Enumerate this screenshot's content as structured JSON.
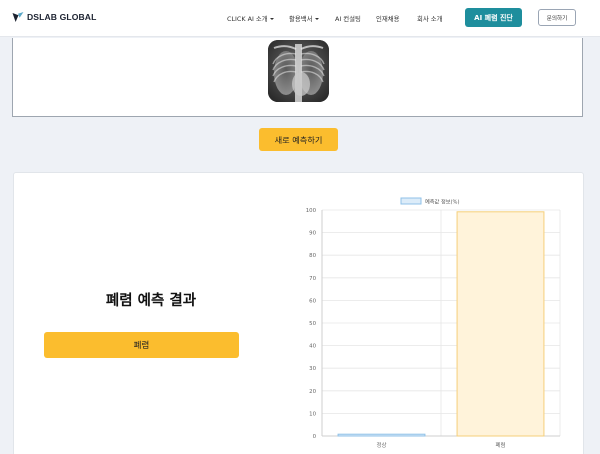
{
  "nav": {
    "brand": "DSLAB GLOBAL",
    "items": [
      {
        "label": "CLICK AI 소개",
        "dropdown": true
      },
      {
        "label": "활용백서",
        "dropdown": true
      },
      {
        "label": "AI 컨설팅",
        "dropdown": false
      },
      {
        "label": "인재채용",
        "dropdown": false
      },
      {
        "label": "회사 소개",
        "dropdown": false
      }
    ],
    "cta_label": "AI 폐렴 진단",
    "contact_label": "문의하기"
  },
  "predict_button": "새로 예측하기",
  "result": {
    "title": "폐렴 예측 결과",
    "label": "폐렴"
  },
  "colors": {
    "accent": "#fbbd2e",
    "primary": "#1e8e9d",
    "normal_bar_fill": "#dcecf9",
    "normal_bar_border": "#8fc1e8",
    "pneumonia_bar_fill": "#fff3da",
    "pneumonia_bar_border": "#f5cf7a"
  },
  "chart_data": {
    "type": "bar",
    "legend": "예측값 정보(%)",
    "legend_position": "top",
    "categories": [
      "정상",
      "폐렴"
    ],
    "values": [
      0.8,
      99.2
    ],
    "ylim": [
      0,
      100
    ],
    "yticks": [
      0,
      10,
      20,
      30,
      40,
      50,
      60,
      70,
      80,
      90,
      100
    ],
    "grid": true
  }
}
